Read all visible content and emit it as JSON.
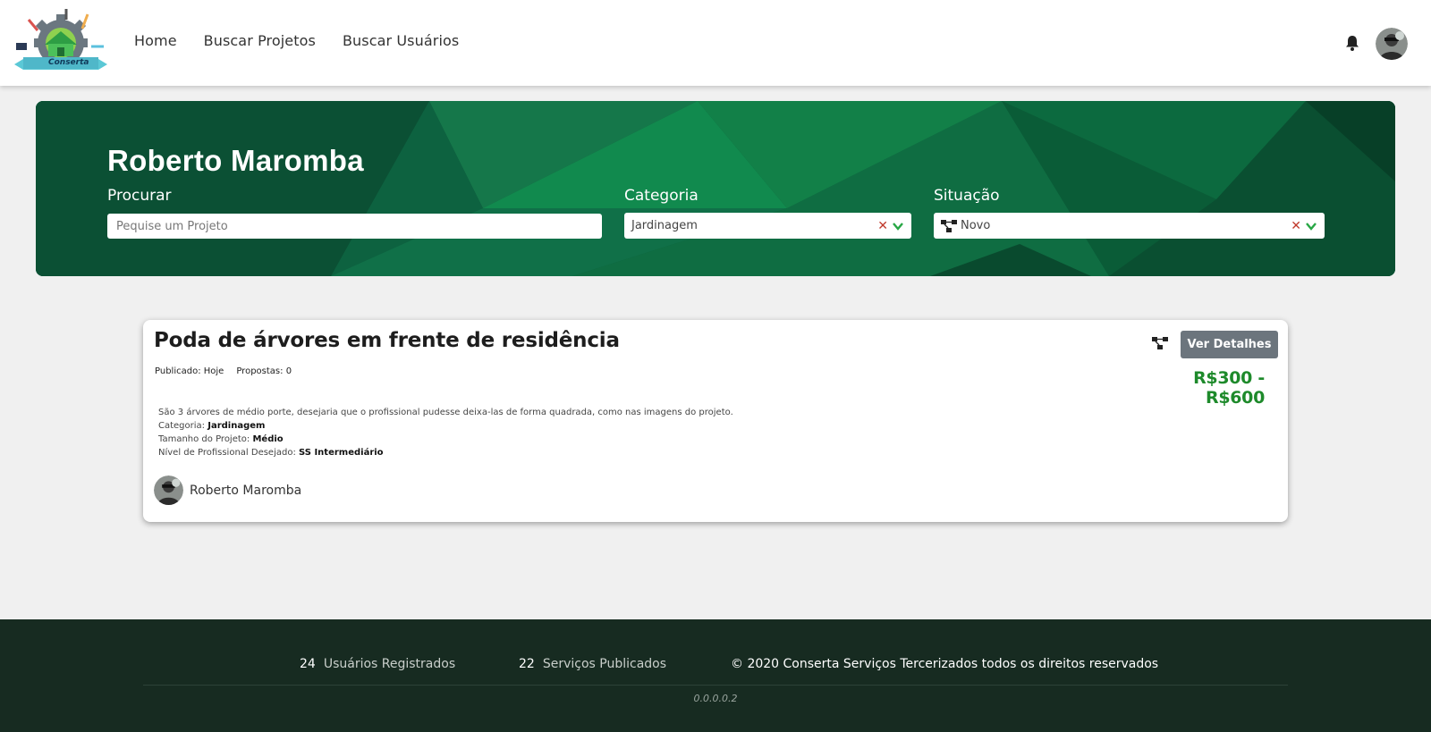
{
  "nav": {
    "logo_text": "Conserta",
    "links": [
      "Home",
      "Buscar Projetos",
      "Buscar Usuários"
    ]
  },
  "hero": {
    "title": "Roberto Maromba",
    "search_label": "Procurar",
    "search_placeholder": "Pequise um Projeto",
    "search_value": "",
    "category_label": "Categoria",
    "category_value": "Jardinagem",
    "status_label": "Situação",
    "status_value": "Novo"
  },
  "project": {
    "title": "Poda de árvores em frente de residência",
    "published_label": "Publicado:",
    "published_value": "Hoje",
    "proposals_label": "Propostas:",
    "proposals_value": "0",
    "description": "São 3 árvores de médio porte, desejaria que o profissional pudesse deixa-las de forma quadrada, como nas imagens do projeto.",
    "category_label": "Categoria:",
    "category_value": "Jardinagem",
    "size_label": "Tamanho do Projeto:",
    "size_value": "Médio",
    "level_label": "Nível de Profissional Desejado:",
    "level_value": "SS Intermediário",
    "owner_name": "Roberto Maromba",
    "details_button": "Ver Detalhes",
    "price_range": "R$300 - R$600"
  },
  "footer": {
    "users_count": "24",
    "users_label": "Usuários Registrados",
    "services_count": "22",
    "services_label": "Serviços Publicados",
    "copyright": "© 2020 Conserta Serviços Tercerizados todos os direitos reservados",
    "version": "0.0.0.0.2"
  },
  "colors": {
    "hero_green": "#0d5a3a",
    "price_green": "#1e8a2b",
    "footer_bg": "#172b21",
    "button_gray": "#6c757d",
    "clear_red": "#c0392b"
  },
  "icons": [
    "bell-icon",
    "network-icon",
    "clear-icon",
    "chevron-down-icon"
  ]
}
